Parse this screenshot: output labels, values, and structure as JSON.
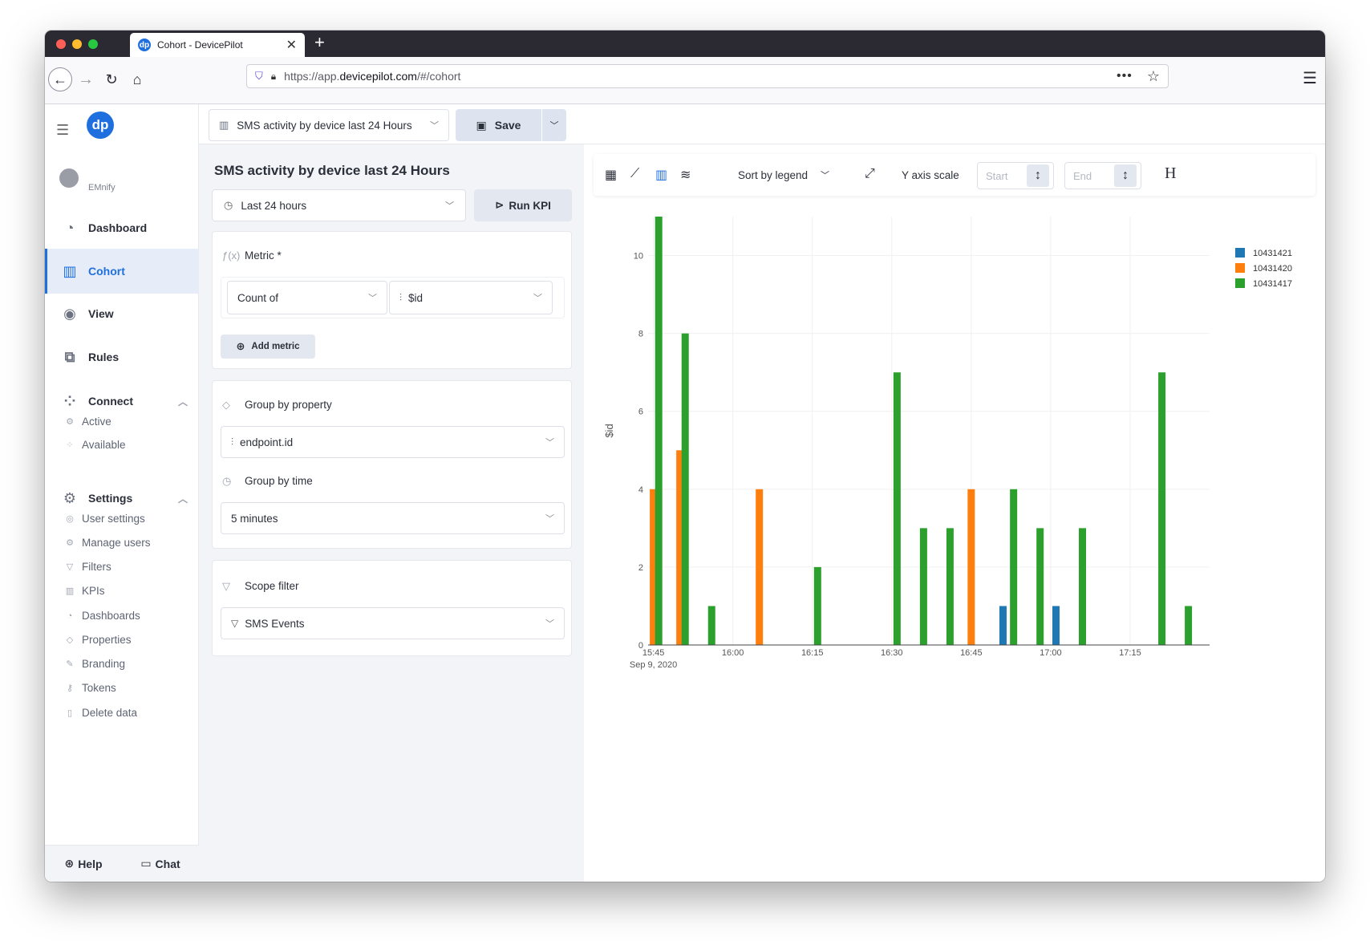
{
  "browser": {
    "tab_title": "Cohort - DevicePilot",
    "tab_favicon": "dp",
    "url_prefix": "https://app.",
    "url_domain": "devicepilot.com",
    "url_path": "/#/cohort"
  },
  "sidebar": {
    "logo": "dp",
    "user": "EMnify",
    "items": [
      {
        "label": "Dashboard",
        "icon": "gauge-icon"
      },
      {
        "label": "Cohort",
        "icon": "bar-chart-icon"
      },
      {
        "label": "View",
        "icon": "eye-icon"
      },
      {
        "label": "Rules",
        "icon": "flow-icon"
      },
      {
        "label": "Connect",
        "icon": "network-icon"
      },
      {
        "label": "Settings",
        "icon": "gears-icon"
      }
    ],
    "connect_sub": [
      "Active",
      "Available"
    ],
    "settings_sub": [
      "User settings",
      "Manage users",
      "Filters",
      "KPIs",
      "Dashboards",
      "Properties",
      "Branding",
      "Tokens",
      "Delete data"
    ],
    "footer": {
      "help": "Help",
      "chat": "Chat"
    }
  },
  "topbar": {
    "kpi_name": "SMS activity by device last 24 Hours",
    "save_label": "Save"
  },
  "panel": {
    "title": "SMS activity by device last 24 Hours",
    "time_range": "Last 24 hours",
    "run_label": "Run KPI",
    "metric_label": "Metric *",
    "metric_agg": "Count of",
    "metric_field": "$id",
    "add_metric": "Add metric",
    "group_prop_label": "Group by property",
    "group_prop_value": "endpoint.id",
    "group_time_label": "Group by time",
    "group_time_value": "5 minutes",
    "scope_label": "Scope filter",
    "scope_value": "SMS Events"
  },
  "chart_toolbar": {
    "sort_label": "Sort by legend",
    "yaxis_label": "Y axis scale",
    "start_placeholder": "Start",
    "end_placeholder": "End",
    "h_label": "H"
  },
  "chart_data": {
    "type": "bar",
    "ylabel": "$id",
    "ylim": [
      0,
      11
    ],
    "yticks": [
      0,
      2,
      4,
      6,
      8,
      10
    ],
    "xticks": [
      "15:45",
      "16:00",
      "16:15",
      "16:30",
      "16:45",
      "17:00",
      "17:15"
    ],
    "xdate": "Sep 9, 2020",
    "legend_position": "top-right",
    "series": [
      {
        "name": "10431421",
        "color": "#1f77b4",
        "points": [
          [
            "16:51",
            1
          ],
          [
            "17:01",
            1
          ]
        ]
      },
      {
        "name": "10431420",
        "color": "#ff7f0e",
        "points": [
          [
            "15:45",
            4
          ],
          [
            "15:50",
            5
          ],
          [
            "16:05",
            4
          ],
          [
            "16:45",
            4
          ]
        ]
      },
      {
        "name": "10431417",
        "color": "#2ca02c",
        "points": [
          [
            "15:46",
            11
          ],
          [
            "15:51",
            8
          ],
          [
            "15:56",
            1
          ],
          [
            "16:16",
            2
          ],
          [
            "16:31",
            7
          ],
          [
            "16:36",
            3
          ],
          [
            "16:41",
            3
          ],
          [
            "16:53",
            4
          ],
          [
            "16:58",
            3
          ],
          [
            "17:06",
            3
          ],
          [
            "17:21",
            7
          ],
          [
            "17:26",
            1
          ]
        ]
      }
    ]
  }
}
